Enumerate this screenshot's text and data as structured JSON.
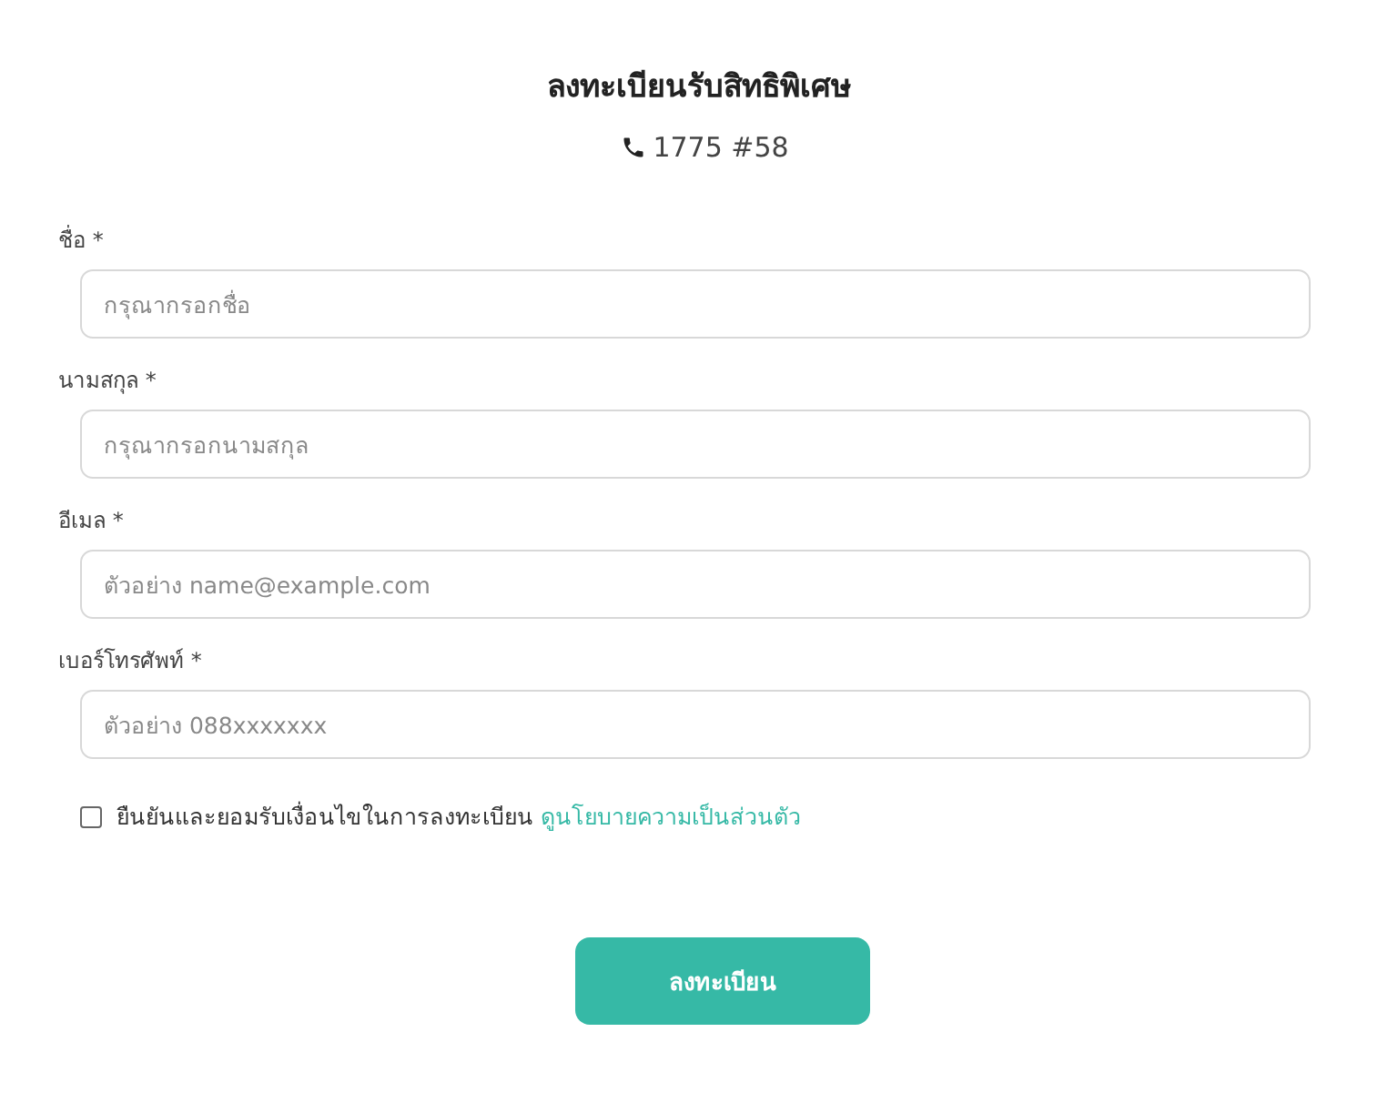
{
  "title": "ลงทะเบียนรับสิทธิพิเศษ",
  "phone": "1775 #58",
  "fields": [
    {
      "label": "ชื่อ *",
      "placeholder": "กรุณากรอกชื่อ"
    },
    {
      "label": "นามสกุล *",
      "placeholder": "กรุณากรอกนามสกุล"
    },
    {
      "label": "อีเมล *",
      "placeholder": "ตัวอย่าง name@example.com"
    },
    {
      "label": "เบอร์โทรศัพท์ *",
      "placeholder": "ตัวอย่าง 088xxxxxxx"
    }
  ],
  "consent": {
    "checked": false,
    "text": "ยืนยันและยอมรับเงื่อนไขในการลงทะเบียน",
    "link": "ดูนโยบายความเป็นส่วนตัว"
  },
  "submit": "ลงทะเบียน"
}
